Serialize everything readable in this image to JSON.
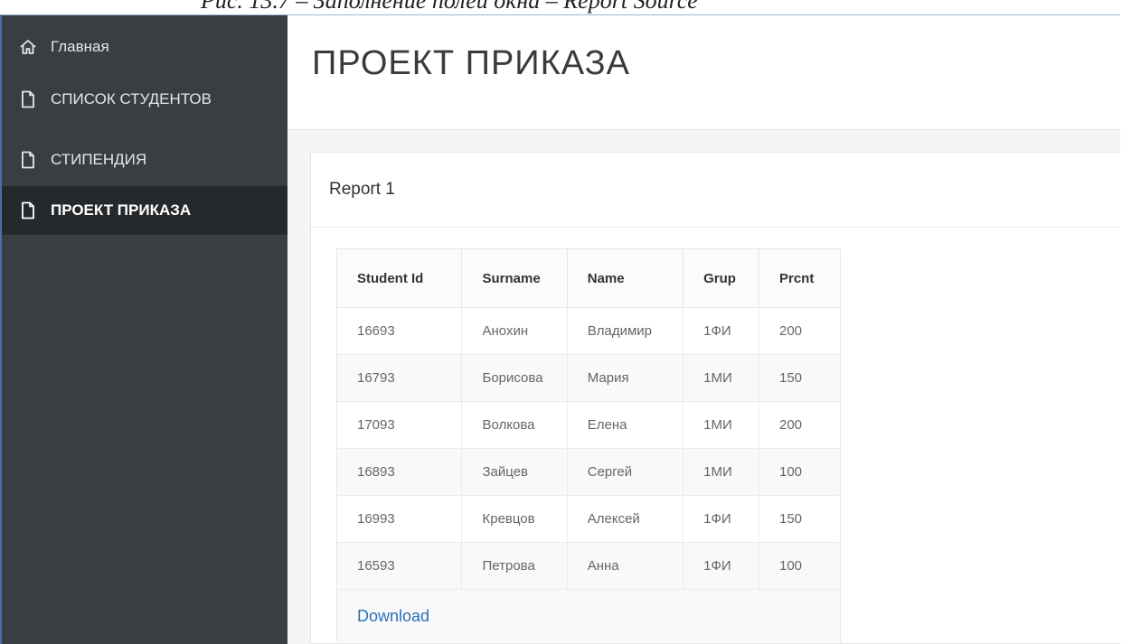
{
  "caption": "Рис. 13.7 – Заполнение полей окна – Report Source",
  "sidebar": {
    "items": [
      {
        "label": "Главная",
        "icon": "home-icon",
        "active": false
      },
      {
        "label": "СПИСОК СТУДЕНТОВ",
        "icon": "page-icon",
        "active": false
      },
      {
        "label": "СТИПЕНДИЯ",
        "icon": "page-icon",
        "active": false
      },
      {
        "label": "ПРОЕКТ ПРИКАЗА",
        "icon": "page-icon",
        "active": true
      }
    ]
  },
  "page": {
    "title": "ПРОЕКТ ПРИКАЗА"
  },
  "region": {
    "title": "Report 1"
  },
  "report": {
    "columns": [
      "Student Id",
      "Surname",
      "Name",
      "Grup",
      "Prcnt"
    ],
    "rows": [
      [
        "16693",
        "Анохин",
        "Владимир",
        "1ФИ",
        "200"
      ],
      [
        "16793",
        "Борисова",
        "Мария",
        "1МИ",
        "150"
      ],
      [
        "17093",
        "Волкова",
        "Елена",
        "1МИ",
        "200"
      ],
      [
        "16893",
        "Зайцев",
        "Сергей",
        "1МИ",
        "100"
      ],
      [
        "16993",
        "Кревцов",
        "Алексей",
        "1ФИ",
        "150"
      ],
      [
        "16593",
        "Петрова",
        "Анна",
        "1ФИ",
        "100"
      ]
    ],
    "download_label": "Download"
  },
  "colors": {
    "sidebar_bg": "#3a3e43",
    "sidebar_active_bg": "#26292c",
    "link": "#2a6fb7"
  }
}
